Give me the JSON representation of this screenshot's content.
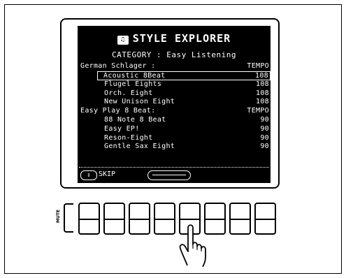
{
  "screen": {
    "title": "STYLE EXPLORER",
    "title_icon": "music-style-icon",
    "category": "CATEGORY : Easy Listening",
    "rows": [
      {
        "kind": "group",
        "name": "German Schlager :",
        "tempo": "TEMPO"
      },
      {
        "kind": "item",
        "name": "Acoustic 8Beat",
        "tempo": "108",
        "selected": true
      },
      {
        "kind": "item",
        "name": "Flugel Eights",
        "tempo": "108"
      },
      {
        "kind": "item",
        "name": "Orch. Eight",
        "tempo": "108"
      },
      {
        "kind": "item",
        "name": "New Unison Eight",
        "tempo": "108"
      },
      {
        "kind": "group",
        "name": "Easy Play 8 Beat:",
        "tempo": "TEMPO"
      },
      {
        "kind": "item",
        "name": "88 Note 8 Beat",
        "tempo": "90"
      },
      {
        "kind": "item",
        "name": "Easy EP!",
        "tempo": "90"
      },
      {
        "kind": "item",
        "name": "Reson-Eight",
        "tempo": "90"
      },
      {
        "kind": "item",
        "name": "Gentle Sax Eight",
        "tempo": "90"
      }
    ],
    "skip_label": "SKIP",
    "skip_icon": "page-skip-icon",
    "dial_icon": "data-dial-icon"
  },
  "panel": {
    "mute_label": "MUTE",
    "button_count": 8,
    "pressed_button_index": 4,
    "pointer_icon": "pointing-hand-icon"
  }
}
